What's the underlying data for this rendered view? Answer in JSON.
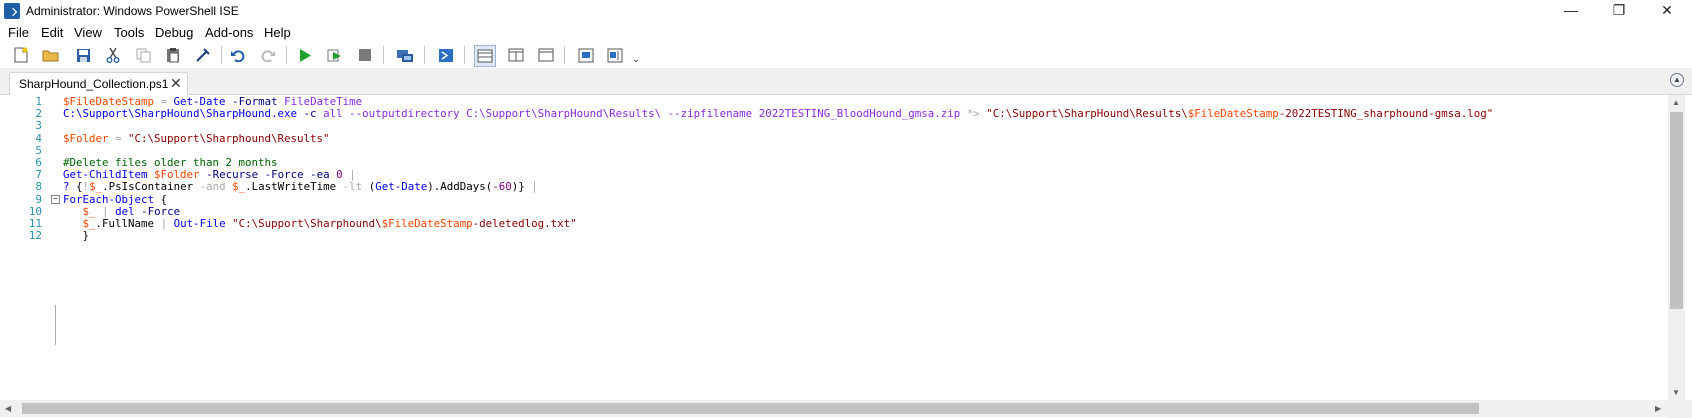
{
  "window": {
    "title": "Administrator: Windows PowerShell ISE",
    "min_glyph": "—",
    "max_glyph": "❐",
    "close_glyph": "✕"
  },
  "menu": [
    "File",
    "Edit",
    "View",
    "Tools",
    "Debug",
    "Add-ons",
    "Help"
  ],
  "toolbar": [
    "new-file-icon",
    "open-folder-icon",
    "save-icon",
    "cut-icon",
    "copy-icon",
    "paste-icon",
    "clear-console-icon",
    "undo-icon",
    "redo-icon",
    "run-script-icon",
    "run-selection-icon",
    "stop-icon",
    "new-remote-tab-icon",
    "start-powershell-icon",
    "show-script-top-icon",
    "show-script-right-icon",
    "show-script-maximized-icon",
    "show-command-window-icon",
    "show-command-addon-icon",
    "customize-toolbar-icon"
  ],
  "tab": {
    "label": "SharpHound_Collection.ps1",
    "close": "✕"
  },
  "editor": {
    "line_numbers": [
      "1",
      "2",
      "3",
      "4",
      "5",
      "6",
      "7",
      "8",
      "9",
      "10",
      "11",
      "12"
    ],
    "lines": [
      [
        [
          "var",
          "$FileDateStamp"
        ],
        [
          "op",
          " = "
        ],
        [
          "cmd",
          "Get-Date"
        ],
        [
          "txt",
          " "
        ],
        [
          "par",
          "-Format"
        ],
        [
          "txt",
          " "
        ],
        [
          "arg",
          "FileDateTime"
        ]
      ],
      [
        [
          "cmd",
          "C:\\Support\\SharpHound\\SharpHound.exe"
        ],
        [
          "txt",
          " "
        ],
        [
          "par",
          "-c"
        ],
        [
          "txt",
          " "
        ],
        [
          "arg",
          "all"
        ],
        [
          "txt",
          " "
        ],
        [
          "arg",
          "--outputdirectory"
        ],
        [
          "txt",
          " "
        ],
        [
          "arg",
          "C:\\Support\\SharpHound\\Results\\"
        ],
        [
          "txt",
          " "
        ],
        [
          "arg",
          "--zipfilename"
        ],
        [
          "txt",
          " "
        ],
        [
          "arg",
          "2022TESTING_BloodHound_gmsa.zip"
        ],
        [
          "txt",
          " "
        ],
        [
          "op",
          "*>"
        ],
        [
          "txt",
          " "
        ],
        [
          "str",
          "\"C:\\Support\\SharpHound\\Results\\"
        ],
        [
          "var",
          "$FileDateStamp"
        ],
        [
          "str",
          "-2022TESTING_sharphound-gmsa.log\""
        ]
      ],
      [],
      [
        [
          "var",
          "$Folder"
        ],
        [
          "op",
          " = "
        ],
        [
          "str",
          "\"C:\\Support\\Sharphound\\Results\""
        ]
      ],
      [],
      [
        [
          "cmt",
          "#Delete files older than 2 months"
        ]
      ],
      [
        [
          "cmd",
          "Get-ChildItem"
        ],
        [
          "txt",
          " "
        ],
        [
          "var",
          "$Folder"
        ],
        [
          "txt",
          " "
        ],
        [
          "par",
          "-Recurse"
        ],
        [
          "txt",
          " "
        ],
        [
          "par",
          "-Force"
        ],
        [
          "txt",
          " "
        ],
        [
          "par",
          "-ea"
        ],
        [
          "txt",
          " "
        ],
        [
          "num",
          "0"
        ],
        [
          "txt",
          " "
        ],
        [
          "op",
          "|"
        ]
      ],
      [
        [
          "cmd",
          "?"
        ],
        [
          "txt",
          " {"
        ],
        [
          "op",
          "!"
        ],
        [
          "var",
          "$_"
        ],
        [
          "mem",
          ".PsIsContainer"
        ],
        [
          "txt",
          " "
        ],
        [
          "op",
          "-and"
        ],
        [
          "txt",
          " "
        ],
        [
          "var",
          "$_"
        ],
        [
          "mem",
          ".LastWriteTime"
        ],
        [
          "txt",
          " "
        ],
        [
          "op",
          "-lt"
        ],
        [
          "txt",
          " ("
        ],
        [
          "cmd",
          "Get-Date"
        ],
        [
          "txt",
          ").AddDays("
        ],
        [
          "num",
          "-60"
        ],
        [
          "txt",
          ")} "
        ],
        [
          "op",
          "|"
        ]
      ],
      [
        [
          "cmd",
          "ForEach-Object"
        ],
        [
          "txt",
          " {"
        ]
      ],
      [
        [
          "txt",
          "   "
        ],
        [
          "var",
          "$_"
        ],
        [
          "txt",
          " "
        ],
        [
          "op",
          "|"
        ],
        [
          "txt",
          " "
        ],
        [
          "cmd",
          "del"
        ],
        [
          "txt",
          " "
        ],
        [
          "par",
          "-Force"
        ]
      ],
      [
        [
          "txt",
          "   "
        ],
        [
          "var",
          "$_"
        ],
        [
          "mem",
          ".FullName"
        ],
        [
          "txt",
          " "
        ],
        [
          "op",
          "|"
        ],
        [
          "txt",
          " "
        ],
        [
          "cmd",
          "Out-File"
        ],
        [
          "txt",
          " "
        ],
        [
          "str",
          "\"C:\\Support\\Sharphound\\"
        ],
        [
          "var",
          "$FileDateStamp"
        ],
        [
          "str",
          "-deletedlog.txt\""
        ]
      ],
      [
        [
          "txt",
          "   }"
        ]
      ]
    ]
  },
  "accent": {
    "string": "#8b0000",
    "variable": "#ff4500",
    "command": "#0000ff",
    "parameter": "#000080",
    "comment": "#006400",
    "number": "#800080",
    "argument": "#8a2be2",
    "operator": "#a9a9a9"
  }
}
